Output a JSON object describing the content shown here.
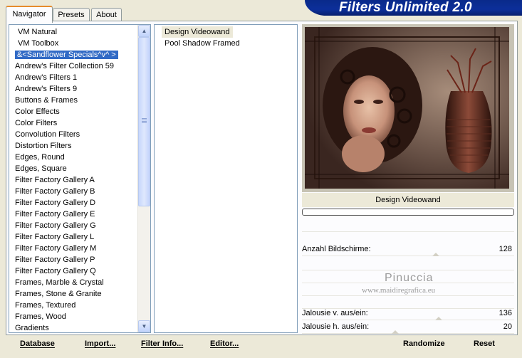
{
  "banner": {
    "title": "Filters Unlimited 2.0"
  },
  "tabs": [
    {
      "label": "Navigator",
      "active": true
    },
    {
      "label": "Presets",
      "active": false
    },
    {
      "label": "About",
      "active": false
    }
  ],
  "categories": [
    "VM Natural",
    "VM Toolbox",
    "&<Sandflower Specials^v^ >",
    "Andrew's Filter Collection 59",
    "Andrew's Filters 1",
    "Andrew's Filters 9",
    "Buttons & Frames",
    "Color Effects",
    "Color Filters",
    "Convolution Filters",
    "Distortion Filters",
    "Edges, Round",
    "Edges, Square",
    "Filter Factory Gallery A",
    "Filter Factory Gallery B",
    "Filter Factory Gallery D",
    "Filter Factory Gallery E",
    "Filter Factory Gallery G",
    "Filter Factory Gallery L",
    "Filter Factory Gallery M",
    "Filter Factory Gallery P",
    "Filter Factory Gallery Q",
    "Frames, Marble & Crystal",
    "Frames, Stone & Granite",
    "Frames, Textured",
    "Frames, Wood",
    "Gradients"
  ],
  "selected_category": "&<Sandflower Specials^v^ >",
  "filters": [
    "Design Videowand",
    "Pool Shadow Framed"
  ],
  "selected_filter": "Design Videowand",
  "preview": {
    "filter_name": "Design Videowand"
  },
  "params": {
    "p1": {
      "label": "Anzahl Bildschirme:",
      "value": "128",
      "level": 0.5
    },
    "p2": {
      "label": "Jalousie v. aus/ein:",
      "value": "136",
      "level": 0.53
    },
    "p3": {
      "label": "Jalousie h. aus/ein:",
      "value": "20",
      "level": 0.08
    }
  },
  "watermark": {
    "name": "Pinuccia",
    "site": "www.maidiregrafica.eu"
  },
  "buttons": {
    "database": "Database",
    "import": "Import...",
    "filter_info": "Filter Info...",
    "editor": "Editor...",
    "randomize": "Randomize",
    "reset": "Reset"
  },
  "colors": {
    "banner": "#0c2f9a",
    "selection": "#316ac5",
    "tab_highlight": "#e68b2c"
  }
}
